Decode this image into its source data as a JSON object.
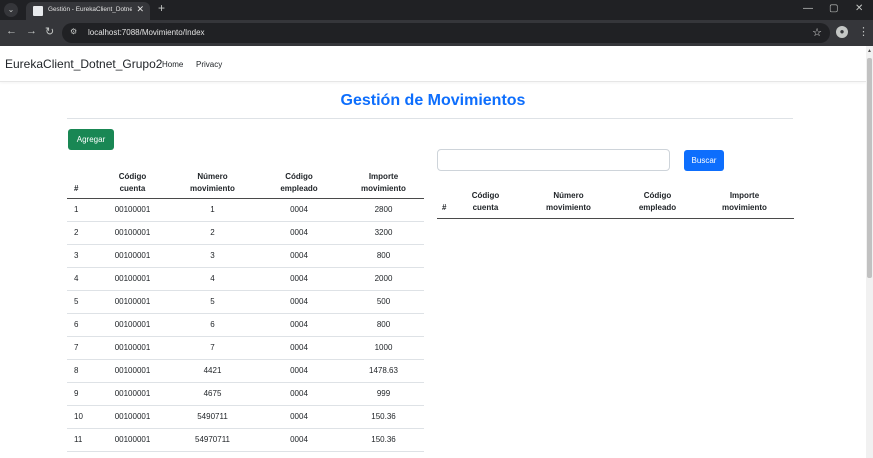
{
  "browser": {
    "tab_title": "Gestión - EurekaClient_Dotnet_",
    "url": "localhost:7088/Movimiento/Index",
    "tab_menu_icon": "chevron-down-icon",
    "minimize_glyph": "—",
    "restore_glyph": "▢",
    "close_glyph": "✕",
    "tab_close_glyph": "✕",
    "new_tab_glyph": "+",
    "back_glyph": "←",
    "forward_glyph": "→",
    "reload_glyph": "↻",
    "star_glyph": "☆",
    "kebab_glyph": "⋮",
    "tune_glyph": "⚙",
    "tab_menu_glyph": "⌄"
  },
  "navbar": {
    "brand": "EurekaClient_Dotnet_Grupo2",
    "links": [
      "Home",
      "Privacy"
    ]
  },
  "heading": "Gestión de Movimientos",
  "actions": {
    "add_label": "Agregar",
    "search_label": "Buscar",
    "search_value": ""
  },
  "columns": {
    "num": "#",
    "cuenta": [
      "Código",
      "cuenta"
    ],
    "movimiento": [
      "Número",
      "movimiento"
    ],
    "empleado": [
      "Código",
      "empleado"
    ],
    "importe": [
      "Importe",
      "movimiento"
    ]
  },
  "movements": [
    {
      "n": "1",
      "cuenta": "00100001",
      "movimiento": "1",
      "empleado": "0004",
      "importe": "2800"
    },
    {
      "n": "2",
      "cuenta": "00100001",
      "movimiento": "2",
      "empleado": "0004",
      "importe": "3200"
    },
    {
      "n": "3",
      "cuenta": "00100001",
      "movimiento": "3",
      "empleado": "0004",
      "importe": "800"
    },
    {
      "n": "4",
      "cuenta": "00100001",
      "movimiento": "4",
      "empleado": "0004",
      "importe": "2000"
    },
    {
      "n": "5",
      "cuenta": "00100001",
      "movimiento": "5",
      "empleado": "0004",
      "importe": "500"
    },
    {
      "n": "6",
      "cuenta": "00100001",
      "movimiento": "6",
      "empleado": "0004",
      "importe": "800"
    },
    {
      "n": "7",
      "cuenta": "00100001",
      "movimiento": "7",
      "empleado": "0004",
      "importe": "1000"
    },
    {
      "n": "8",
      "cuenta": "00100001",
      "movimiento": "4421",
      "empleado": "0004",
      "importe": "1478.63"
    },
    {
      "n": "9",
      "cuenta": "00100001",
      "movimiento": "4675",
      "empleado": "0004",
      "importe": "999"
    },
    {
      "n": "10",
      "cuenta": "00100001",
      "movimiento": "5490711",
      "empleado": "0004",
      "importe": "150.36"
    },
    {
      "n": "11",
      "cuenta": "00100001",
      "movimiento": "54970711",
      "empleado": "0004",
      "importe": "150.36"
    }
  ]
}
